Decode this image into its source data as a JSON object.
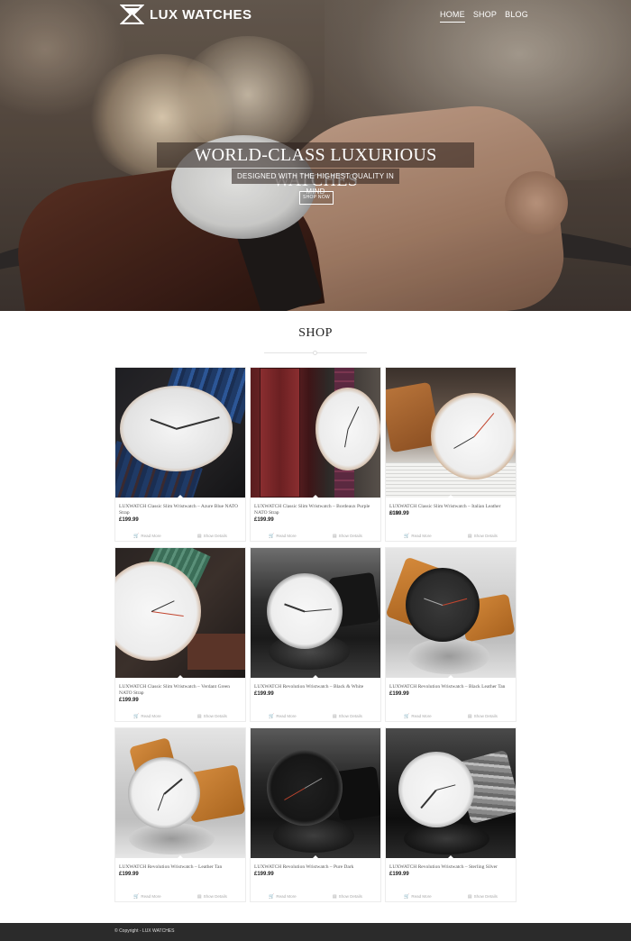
{
  "brand": {
    "name": "LUX WATCHES"
  },
  "nav": {
    "items": [
      "HOME",
      "SHOP",
      "BLOG"
    ]
  },
  "hero": {
    "title": "WORLD-CLASS LUXURIOUS WATCHES",
    "subtitle": "DESIGNED WITH THE HIGHEST QUALITY IN MIND",
    "button": "SHOP NOW"
  },
  "shop": {
    "heading": "SHOP"
  },
  "product_actions": {
    "read_more": "Read More",
    "show_details": "Show Details"
  },
  "products": [
    {
      "name": "LUXWATCH Classic Slim Wristwatch – Azure Blue NATO Strap",
      "price": "£199.99"
    },
    {
      "name": "LUXWATCH Classic Slim Wristwatch – Bordeaux Purple NATO Strap",
      "price": "£199.99"
    },
    {
      "name": "LUXWATCH Classic Slim Wristwatch – Italian Leather Strap",
      "price": "£199.99"
    },
    {
      "name": "LUXWATCH Classic Slim Wristwatch – Verdant Green NATO Strap",
      "price": "£199.99"
    },
    {
      "name": "LUXWATCH Revolution Wristwatch – Black & White",
      "price": "£199.99"
    },
    {
      "name": "LUXWATCH Revolution Wristwatch – Black Leather Tan",
      "price": "£199.99"
    },
    {
      "name": "LUXWATCH Revolution Wristwatch – Leather Tan",
      "price": "£199.99"
    },
    {
      "name": "LUXWATCH Revolution Wristwatch – Pure Dark",
      "price": "£199.99"
    },
    {
      "name": "LUXWATCH Revolution Wristwatch – Sterling Silver",
      "price": "£199.99"
    }
  ],
  "footer": {
    "copyright": "© Copyright - LUX WATCHES"
  },
  "icons": {
    "cart": "cart-icon",
    "details": "document-icon"
  },
  "colors": {
    "footer": "#2b2b2b",
    "accent_red": "#c2452e"
  }
}
